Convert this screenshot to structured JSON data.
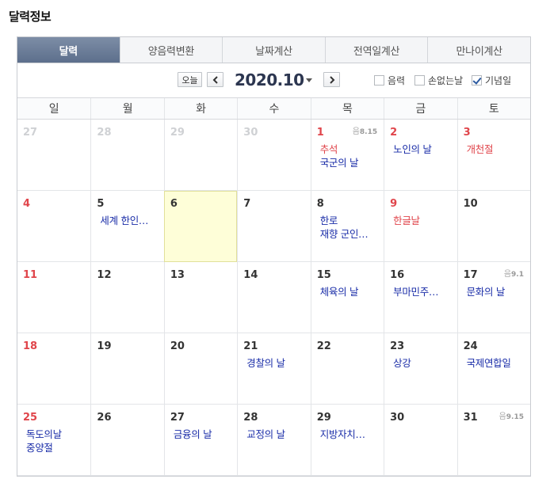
{
  "page_title": "달력정보",
  "tabs": [
    {
      "label": "달력",
      "active": true
    },
    {
      "label": "양음력변환",
      "active": false
    },
    {
      "label": "날짜계산",
      "active": false
    },
    {
      "label": "전역일계산",
      "active": false
    },
    {
      "label": "만나이계산",
      "active": false
    }
  ],
  "nav": {
    "today_label": "오늘",
    "prev_icon": "chevron-left-icon",
    "next_icon": "chevron-right-icon",
    "month_label": "2020.10",
    "options": [
      {
        "label": "음력",
        "checked": false
      },
      {
        "label": "손없는날",
        "checked": false
      },
      {
        "label": "기념일",
        "checked": true
      }
    ]
  },
  "weekdays": [
    "일",
    "월",
    "화",
    "수",
    "목",
    "금",
    "토"
  ],
  "colors": {
    "accent": "#5d6f8c",
    "sunday": "#e0454b",
    "event": "#1a2da8",
    "today": "#fefed8"
  },
  "days": [
    {
      "num": "27",
      "type": "other",
      "events": []
    },
    {
      "num": "28",
      "type": "other",
      "events": []
    },
    {
      "num": "29",
      "type": "other",
      "events": []
    },
    {
      "num": "30",
      "type": "other",
      "events": []
    },
    {
      "num": "1",
      "type": "sun",
      "lunar": "8.15",
      "events": [
        {
          "text": "추석",
          "hol": true
        },
        {
          "text": "국군의 날",
          "hol": false
        }
      ]
    },
    {
      "num": "2",
      "type": "sun",
      "events": [
        {
          "text": "노인의 날",
          "hol": false
        }
      ]
    },
    {
      "num": "3",
      "type": "sun",
      "events": [
        {
          "text": "개천절",
          "hol": true
        }
      ]
    },
    {
      "num": "4",
      "type": "sun",
      "events": []
    },
    {
      "num": "5",
      "type": "normal",
      "events": [
        {
          "text": "세계 한인…",
          "hol": false
        }
      ]
    },
    {
      "num": "6",
      "type": "normal",
      "today": true,
      "events": []
    },
    {
      "num": "7",
      "type": "normal",
      "events": []
    },
    {
      "num": "8",
      "type": "normal",
      "events": [
        {
          "text": "한로",
          "hol": false
        },
        {
          "text": "재향 군인…",
          "hol": false
        }
      ]
    },
    {
      "num": "9",
      "type": "sun",
      "events": [
        {
          "text": "한글날",
          "hol": true
        }
      ]
    },
    {
      "num": "10",
      "type": "normal",
      "events": []
    },
    {
      "num": "11",
      "type": "sun",
      "events": []
    },
    {
      "num": "12",
      "type": "normal",
      "events": []
    },
    {
      "num": "13",
      "type": "normal",
      "events": []
    },
    {
      "num": "14",
      "type": "normal",
      "events": []
    },
    {
      "num": "15",
      "type": "normal",
      "events": [
        {
          "text": "체육의 날",
          "hol": false
        }
      ]
    },
    {
      "num": "16",
      "type": "normal",
      "events": [
        {
          "text": "부마민주…",
          "hol": false
        }
      ]
    },
    {
      "num": "17",
      "type": "normal",
      "lunar": "9.1",
      "events": [
        {
          "text": "문화의 날",
          "hol": false
        }
      ]
    },
    {
      "num": "18",
      "type": "sun",
      "events": []
    },
    {
      "num": "19",
      "type": "normal",
      "events": []
    },
    {
      "num": "20",
      "type": "normal",
      "events": []
    },
    {
      "num": "21",
      "type": "normal",
      "events": [
        {
          "text": "경찰의 날",
          "hol": false
        }
      ]
    },
    {
      "num": "22",
      "type": "normal",
      "events": []
    },
    {
      "num": "23",
      "type": "normal",
      "events": [
        {
          "text": "상강",
          "hol": false
        }
      ]
    },
    {
      "num": "24",
      "type": "normal",
      "events": [
        {
          "text": "국제연합일",
          "hol": false
        }
      ]
    },
    {
      "num": "25",
      "type": "sun",
      "events": [
        {
          "text": "독도의날",
          "hol": false
        },
        {
          "text": "중양절",
          "hol": false
        }
      ]
    },
    {
      "num": "26",
      "type": "normal",
      "events": []
    },
    {
      "num": "27",
      "type": "normal",
      "events": [
        {
          "text": "금융의 날",
          "hol": false
        }
      ]
    },
    {
      "num": "28",
      "type": "normal",
      "events": [
        {
          "text": "교정의 날",
          "hol": false
        }
      ]
    },
    {
      "num": "29",
      "type": "normal",
      "events": [
        {
          "text": "지방자치…",
          "hol": false
        }
      ]
    },
    {
      "num": "30",
      "type": "normal",
      "events": []
    },
    {
      "num": "31",
      "type": "normal",
      "lunar": "9.15",
      "events": []
    }
  ],
  "lunar_prefix": "음"
}
